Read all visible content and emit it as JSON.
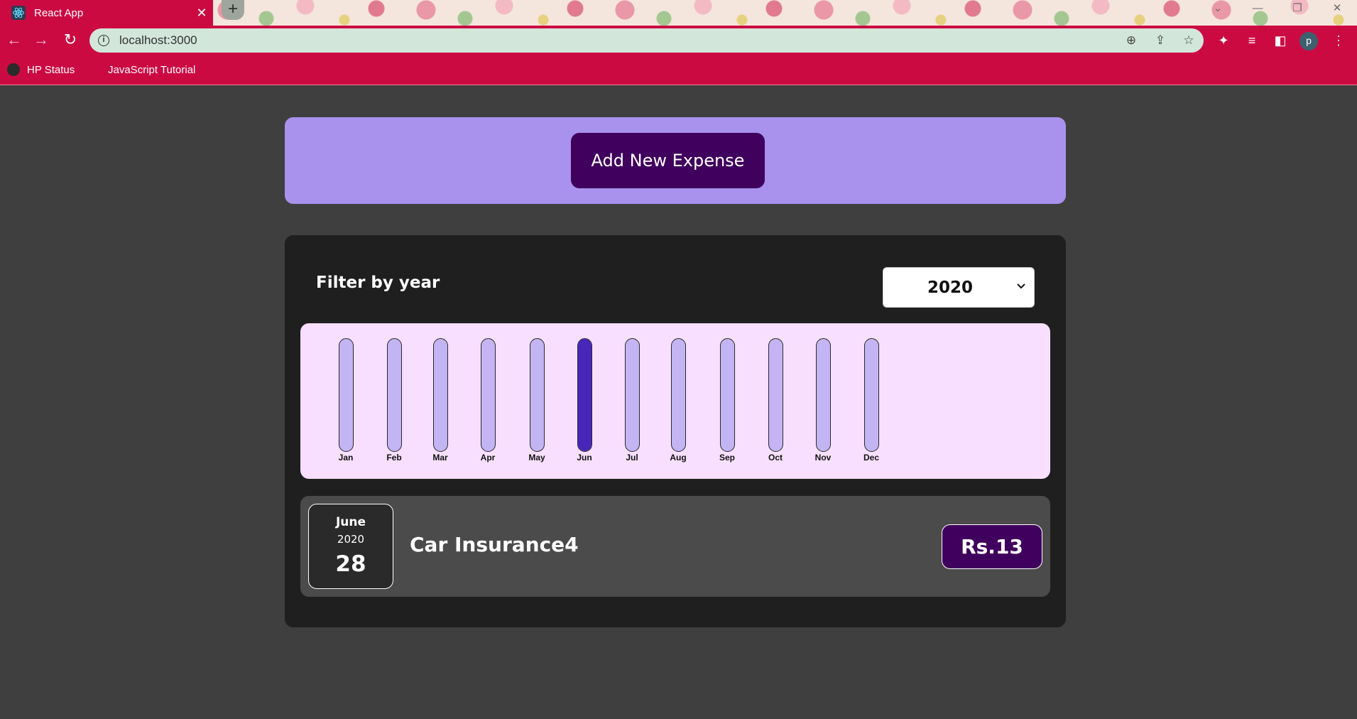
{
  "browser": {
    "tab_title": "React App",
    "tab_close": "✕",
    "new_tab": "+",
    "url": "localhost:3000",
    "avatar_letter": "p",
    "bookmarks": [
      {
        "label": "HP Status"
      },
      {
        "label": "JavaScript Tutorial"
      }
    ],
    "tab_color": "#cc0a42"
  },
  "new_expense": {
    "button_label": "Add New Expense"
  },
  "filter": {
    "label": "Filter by year",
    "selected_year": "2020"
  },
  "chart_data": {
    "type": "bar",
    "categories": [
      "Jan",
      "Feb",
      "Mar",
      "Apr",
      "May",
      "Jun",
      "Jul",
      "Aug",
      "Sep",
      "Oct",
      "Nov",
      "Dec"
    ],
    "values": [
      0,
      0,
      0,
      0,
      0,
      13,
      0,
      0,
      0,
      0,
      0,
      0
    ],
    "max_value": 13,
    "fill_color": "#4826b9",
    "track_color": "#c3b4f3"
  },
  "expenses": [
    {
      "month": "June",
      "year": "2020",
      "day": "28",
      "title": "Car Insurance4",
      "amount": "Rs.13"
    }
  ],
  "colors": {
    "accent": "#40005d",
    "new_expense_bg": "#a892ee",
    "chart_bg": "#f8dfff"
  }
}
